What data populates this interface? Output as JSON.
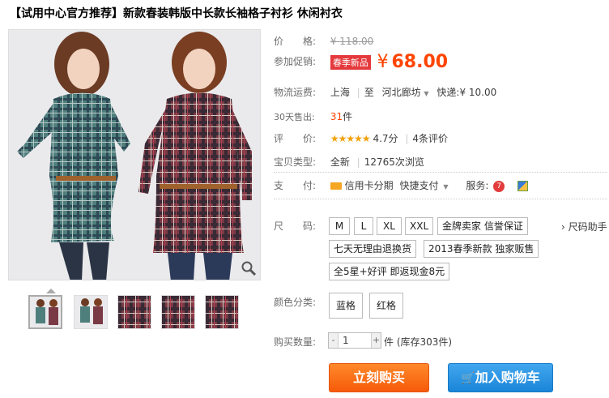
{
  "title": "【试用中心官方推荐】新款春装韩版中长款长袖格子衬衫 休闲衬衣",
  "price": {
    "label": "价　　格:",
    "currency": "¥",
    "original": "118.00"
  },
  "promo": {
    "label": "参加促销:",
    "badge": "春季新品",
    "currency": "¥",
    "price": "68.00"
  },
  "shipping": {
    "label": "物流运费:",
    "from": "上海",
    "to_prefix": "至",
    "to": "河北廊坊",
    "method": "快递:",
    "fee": "¥ 10.00"
  },
  "sold": {
    "label": "30天售出:",
    "count": "31",
    "unit": "件"
  },
  "rating": {
    "label": "评　　价:",
    "stars": "★★★★★",
    "score": "4.7分",
    "reviews": "4条评价"
  },
  "type": {
    "label": "宝贝类型:",
    "condition": "全新",
    "views": "12765次浏览"
  },
  "payment": {
    "label": "支　　付:",
    "credit": "信用卡分期",
    "quick": "快捷支付",
    "service_label": "服务:"
  },
  "size": {
    "label": "尺　　码:",
    "options": [
      "M",
      "L",
      "XL",
      "XXL"
    ],
    "tags": [
      "金牌卖家 信誉保证",
      "七天无理由退换货",
      "2013春季新款 独家贩售",
      "全5星+好评 即返现金8元"
    ],
    "help": "› 尺码助手"
  },
  "color": {
    "label": "颜色分类:",
    "options": [
      "蓝格",
      "红格"
    ]
  },
  "quantity": {
    "label": "购买数量:",
    "value": "1",
    "minus": "-",
    "plus": "+",
    "unit": "件",
    "stock": "(库存303件)"
  },
  "actions": {
    "buy_now": "立刻购买",
    "add_to_cart": "加入购物车"
  },
  "colors": {
    "accent": "#ff4400",
    "buy_button": "#f65a0a",
    "cart_button": "#1a85d8",
    "promo_badge": "#e4393c"
  }
}
